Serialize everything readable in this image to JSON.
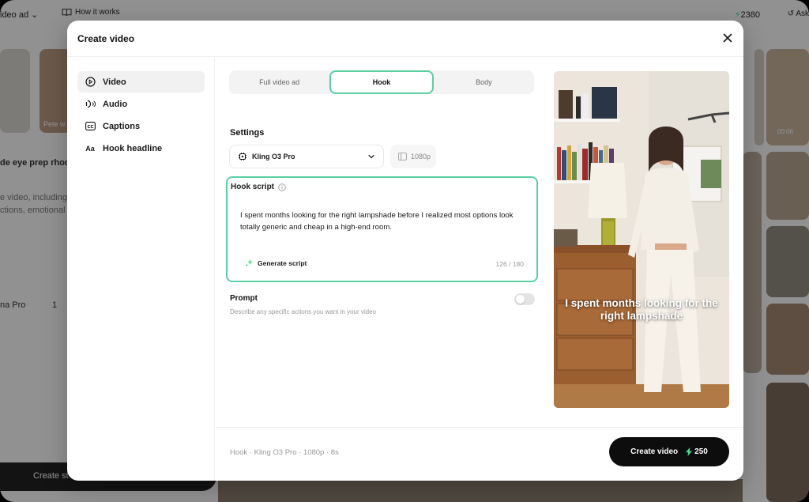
{
  "background": {
    "topbar": {
      "mode_label": "ideo ad",
      "how_it_works": "How it works",
      "credits": "2380",
      "ask": "Ask"
    },
    "left_texts": [
      "de eye prep rhode",
      "e video, including t",
      "ctions, emotional t",
      "na Pro",
      "1"
    ],
    "tile_label": "Pete w",
    "tile_time": "00:06",
    "bottom_button": "Create st"
  },
  "modal": {
    "title": "Create video",
    "sidebar": [
      {
        "label": "Video",
        "icon": "play-circle-icon",
        "active": true
      },
      {
        "label": "Audio",
        "icon": "audio-wave-icon",
        "active": false
      },
      {
        "label": "Captions",
        "icon": "captions-icon",
        "active": false
      },
      {
        "label": "Hook headline",
        "icon": "text-aa-icon",
        "active": false
      }
    ],
    "tabs": [
      {
        "label": "Full video ad",
        "active": false
      },
      {
        "label": "Hook",
        "active": true
      },
      {
        "label": "Body",
        "active": false
      }
    ],
    "settings": {
      "label": "Settings",
      "model": "Kling O3 Pro",
      "resolution": "1080p"
    },
    "hook_script": {
      "label": "Hook script",
      "text": "I spent months looking for the right lampshade before I realized most options look totally generic and cheap in a high-end room.",
      "generate_label": "Generate script",
      "counter": "126 / 180"
    },
    "prompt": {
      "label": "Prompt",
      "description": "Describe any specific actions you want in your video",
      "enabled": false
    },
    "preview": {
      "caption": "I spent months looking for the right lampshade"
    },
    "footer": {
      "summary": "Hook · Kling O3 Pro · 1080p · 8s",
      "create_label": "Create video",
      "cost": "250"
    }
  },
  "colors": {
    "accent": "#5ad0a2",
    "bolt": "#3ddc84",
    "primary_button": "#0d0d0d"
  }
}
